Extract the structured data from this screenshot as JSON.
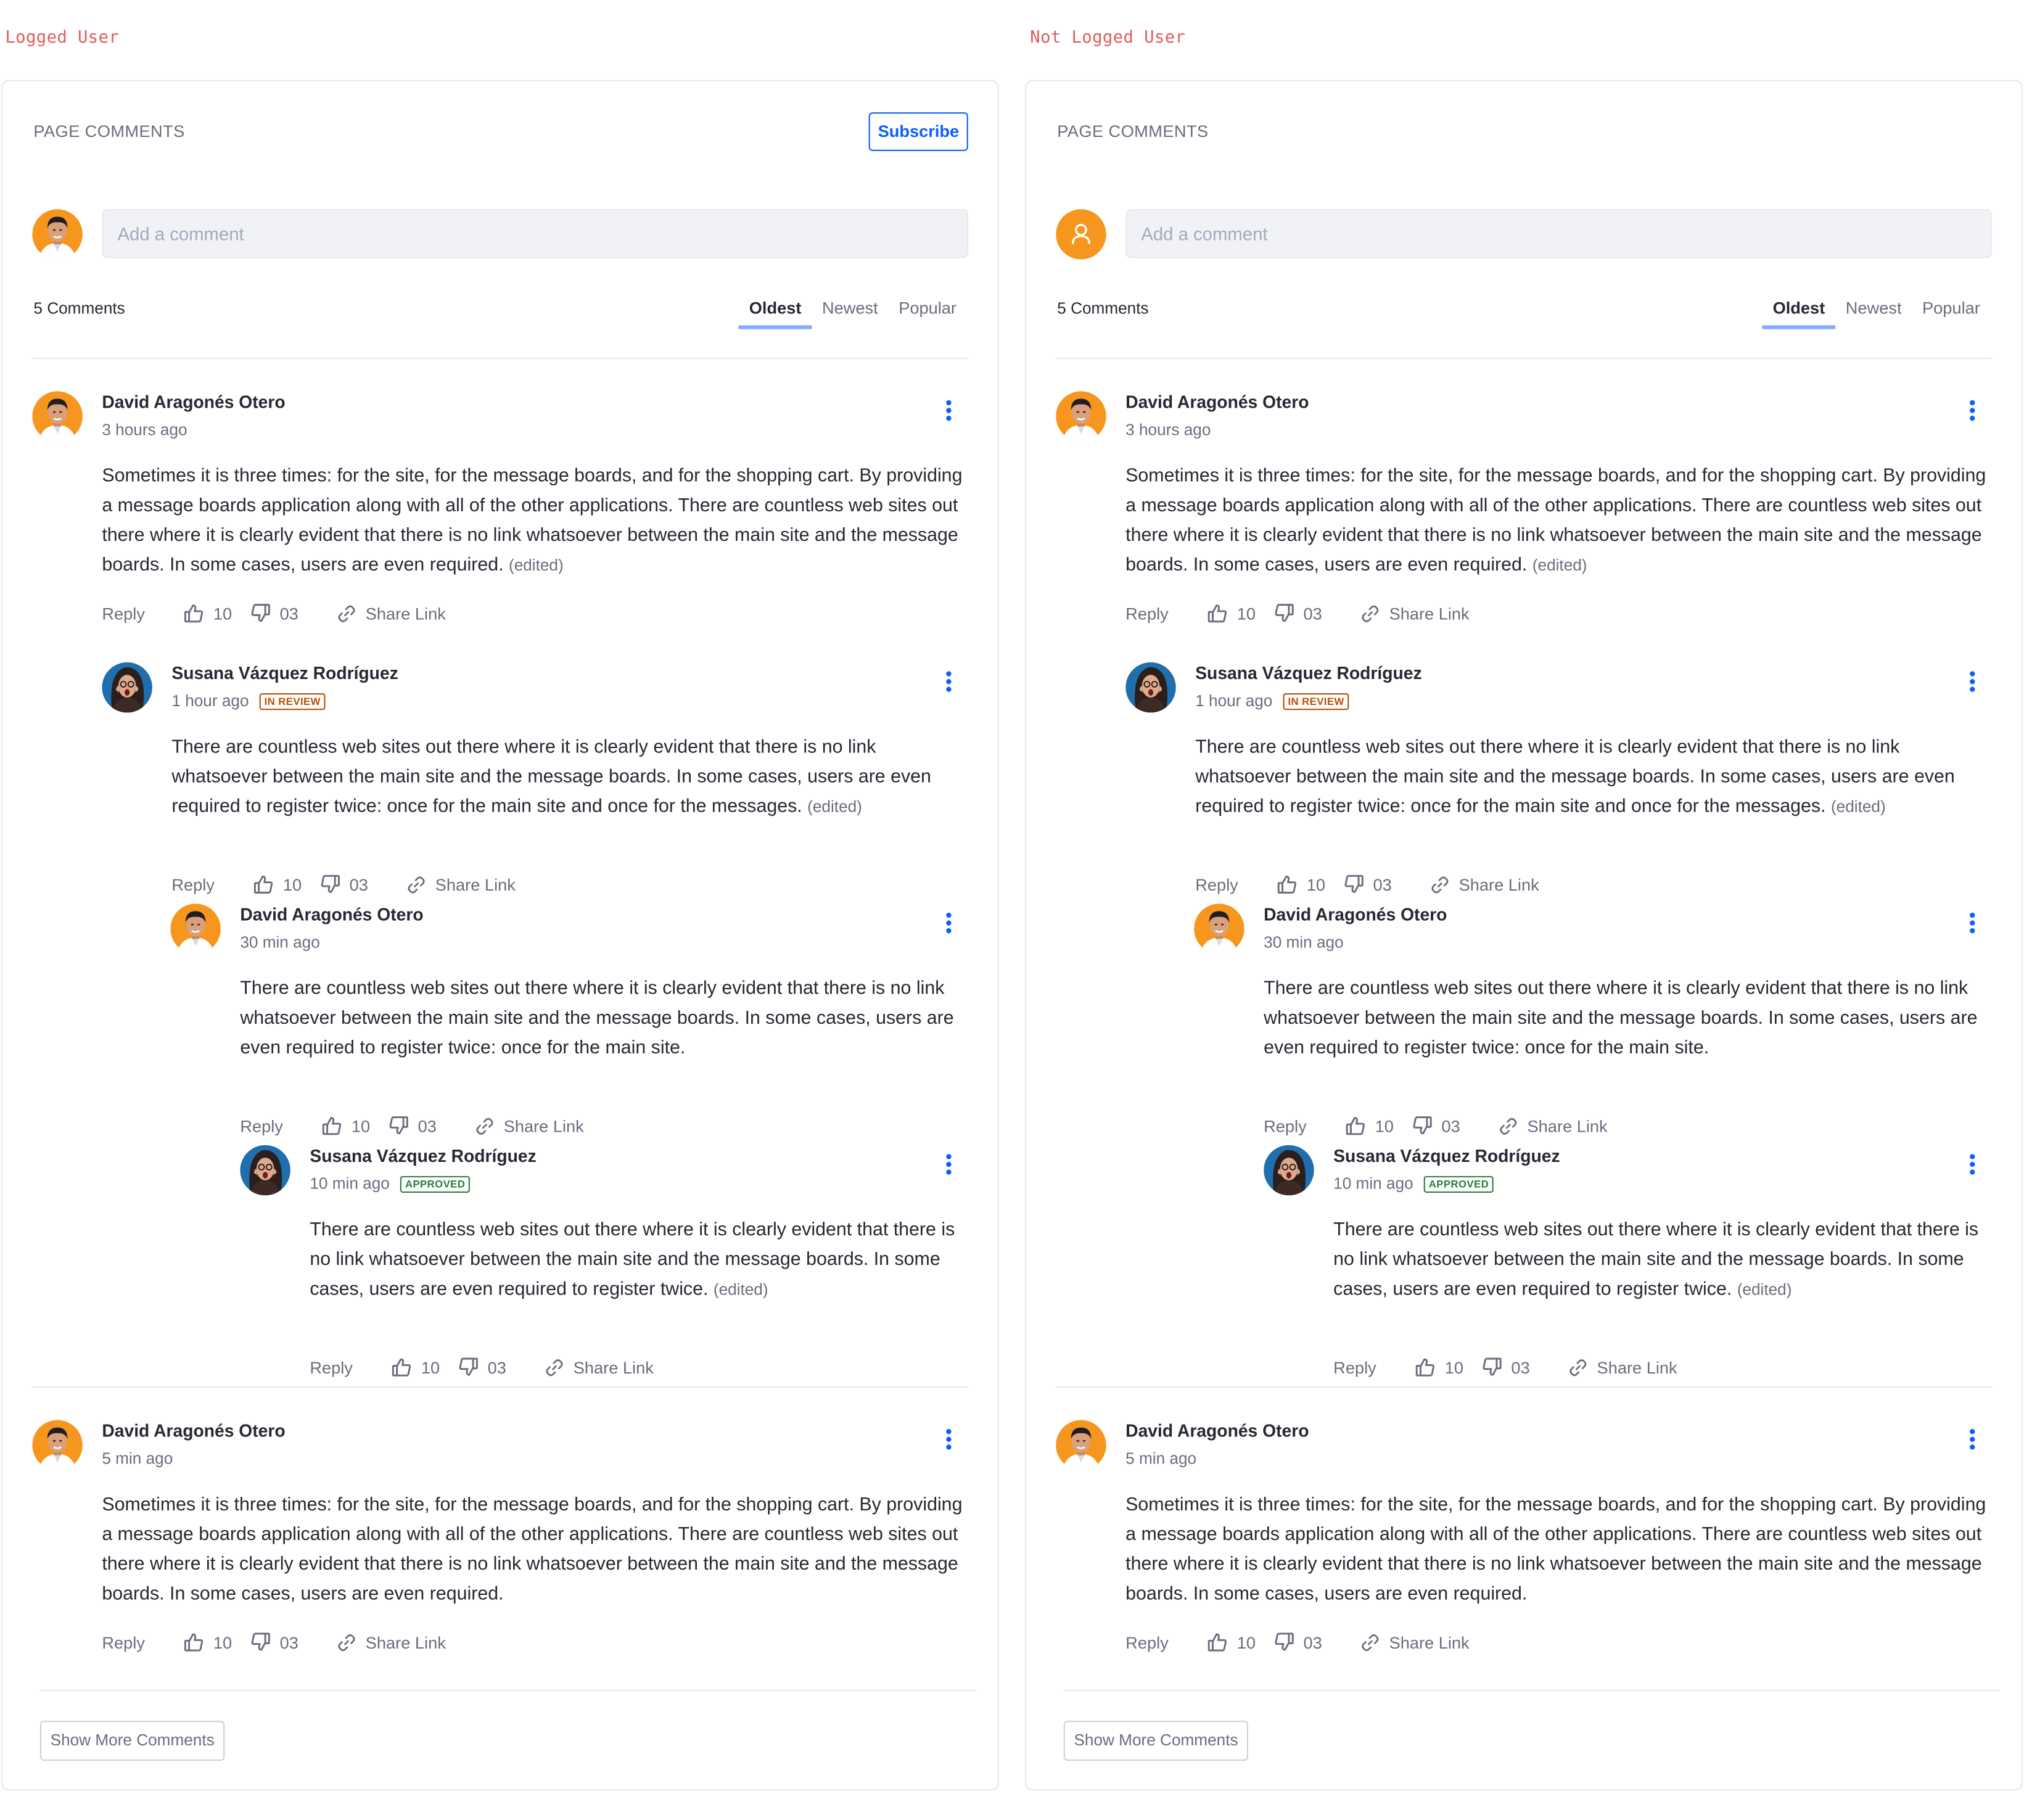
{
  "captions": {
    "logged": "Logged User",
    "not_logged": "Not Logged User"
  },
  "panel": {
    "title": "PAGE COMMENTS",
    "subscribe_label": "Subscribe",
    "input_placeholder": "Add a comment",
    "count": "5 Comments",
    "tabs": [
      "Oldest",
      "Newest",
      "Popular"
    ],
    "active_tab": "Oldest",
    "show_more_label": "Show More Comments"
  },
  "comments": [
    {
      "author": "David Aragonés Otero",
      "time": "3 hours ago",
      "badge": "",
      "text": "Sometimes it is three times: for the site, for the message boards, and for the shopping cart. By providing a message boards application along with all of the other applications. There are countless web sites out there where it is clearly evident that there is no link whatsoever between the main site and the message boards. In some cases, users are even required.",
      "edited": "(edited)",
      "likes": "10",
      "dislikes": "03",
      "reply_label": "Reply",
      "share_label": "Share Link"
    },
    {
      "author": "Susana Vázquez Rodríguez",
      "time": "1 hour ago",
      "badge": "IN REVIEW",
      "text": "There are countless web sites out there where it is clearly evident that there is no link whatsoever between the main site and the message boards. In some cases, users are even required to register twice: once for the main site and once for the messages.",
      "edited": "(edited)",
      "likes": "10",
      "dislikes": "03",
      "reply_label": "Reply",
      "share_label": "Share Link"
    },
    {
      "author": "David Aragonés Otero",
      "time": "30 min ago",
      "badge": "",
      "text": "There are countless web sites out there where it is clearly evident that there is no link whatsoever between the main site and the message boards. In some cases, users are even required to register twice: once for the main site.",
      "edited": "",
      "likes": "10",
      "dislikes": "03",
      "reply_label": "Reply",
      "share_label": "Share Link"
    },
    {
      "author": "Susana Vázquez Rodríguez",
      "time": "10 min ago",
      "badge": "APPROVED",
      "text": "There are countless web sites out there where it is clearly evident that there is no link whatsoever between the main site and the message boards. In some cases, users are even required to register twice.",
      "edited": "(edited)",
      "likes": "10",
      "dislikes": "03",
      "reply_label": "Reply",
      "share_label": "Share Link"
    },
    {
      "author": "David Aragonés Otero",
      "time": "5 min ago",
      "badge": "",
      "text": "Sometimes it is three times: for the site, for the message boards, and for the shopping cart. By providing a message boards application along with all of the other applications. There are countless web sites out there where it is clearly evident that there is no link whatsoever between the main site and the message boards. In some cases, users are even required.",
      "edited": "",
      "likes": "10",
      "dislikes": "03",
      "reply_label": "Reply",
      "share_label": "Share Link"
    }
  ],
  "colors": {
    "accent": "#0b5fff",
    "tab_indicator": "#80acff",
    "caption": "#e05d5d",
    "avatar_orange": "#f7961e",
    "review": "#b95000",
    "approved": "#287d3c"
  }
}
